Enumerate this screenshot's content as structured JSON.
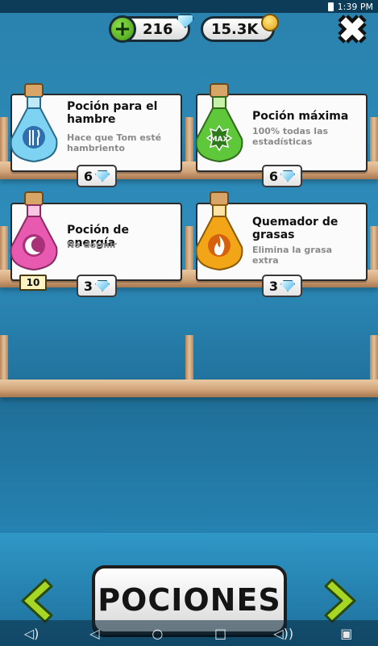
{
  "status_bar": {
    "time": "1:39 PM"
  },
  "currency": {
    "gems": "216",
    "coins": "15.3K",
    "add_label": "+"
  },
  "close_label": "✖",
  "potions": [
    {
      "title": "Poción para el hambre",
      "description": "Hace que Tom esté hambriento",
      "price": "6",
      "color": "#7fd3f2",
      "symbol": "fork-knife-icon"
    },
    {
      "title": "Poción máxima",
      "description": "100% todas las estadísticas",
      "price": "6",
      "color": "#5fc83a",
      "symbol": "max-badge-icon",
      "symbol_text": "MAX"
    },
    {
      "title": "Poción de energía",
      "description": "No dormir",
      "price": "3",
      "color": "#e85ab0",
      "symbol": "moon-icon",
      "owned": "10"
    },
    {
      "title": "Quemador de grasas",
      "description": "Elimina la grasa extra",
      "price": "3",
      "color": "#f2a516",
      "symbol": "flame-icon"
    }
  ],
  "footer": {
    "title": "POCIONES",
    "prev_icon": "chevron-left-icon",
    "next_icon": "chevron-right-icon"
  },
  "colors": {
    "background": "#2a82ad",
    "shelf": "#d3a57a",
    "arrow_green": "#a8d625"
  }
}
